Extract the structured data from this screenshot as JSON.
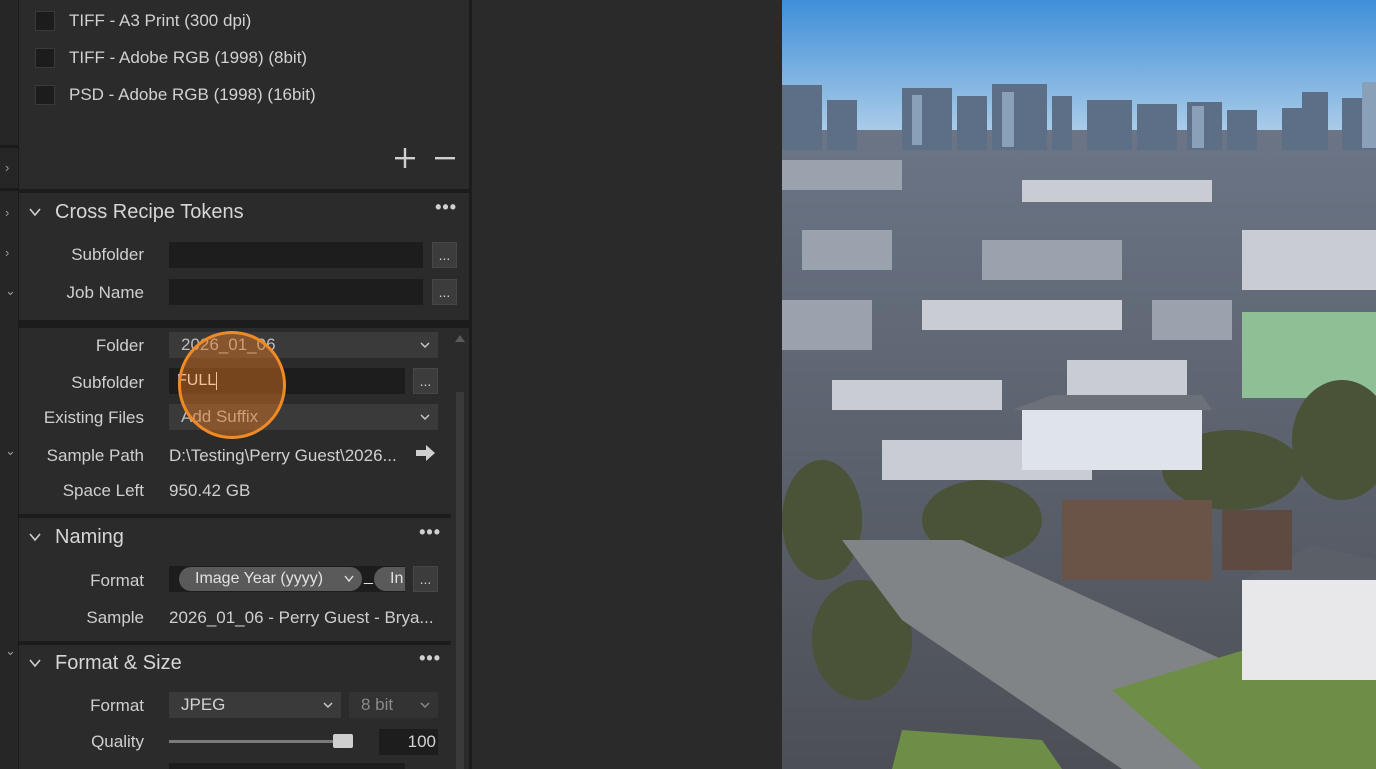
{
  "recipes": {
    "items": [
      {
        "label": "TIFF - A3 Print (300 dpi)"
      },
      {
        "label": "TIFF - Adobe RGB (1998) (8bit)"
      },
      {
        "label": "PSD - Adobe RGB (1998) (16bit)"
      }
    ],
    "add_icon": "plus-icon",
    "remove_icon": "minus-icon"
  },
  "cross_recipe_tokens": {
    "title": "Cross Recipe Tokens",
    "more": "•••",
    "subfolder_label": "Subfolder",
    "subfolder_value": "",
    "job_name_label": "Job Name",
    "job_name_value": "",
    "dots": "..."
  },
  "output_location": {
    "folder_label": "Folder",
    "folder_value": "2026_01_06",
    "subfolder_label": "Subfolder",
    "subfolder_value": "FULL",
    "existing_files_label": "Existing Files",
    "existing_files_value": "Add Suffix",
    "sample_path_label": "Sample Path",
    "sample_path_value": "D:\\Testing\\Perry Guest\\2026...",
    "space_left_label": "Space Left",
    "space_left_value": "950.42 GB",
    "dots": "..."
  },
  "naming": {
    "title": "Naming",
    "more": "•••",
    "format_label": "Format",
    "token1": "Image Year (yyyy)",
    "separator": "_",
    "token2": "In",
    "sample_label": "Sample",
    "sample_value": "2026_01_06 - Perry Guest - Brya...",
    "dots": "..."
  },
  "format_size": {
    "title": "Format & Size",
    "more": "•••",
    "format_label": "Format",
    "format_value": "JPEG",
    "bit_depth_value": "8 bit",
    "quality_label": "Quality",
    "quality_value": "100",
    "quality_fraction": 1.0
  },
  "colors": {
    "accent_cursor": "#f08a24",
    "panel_bg": "#2b2b2b"
  }
}
